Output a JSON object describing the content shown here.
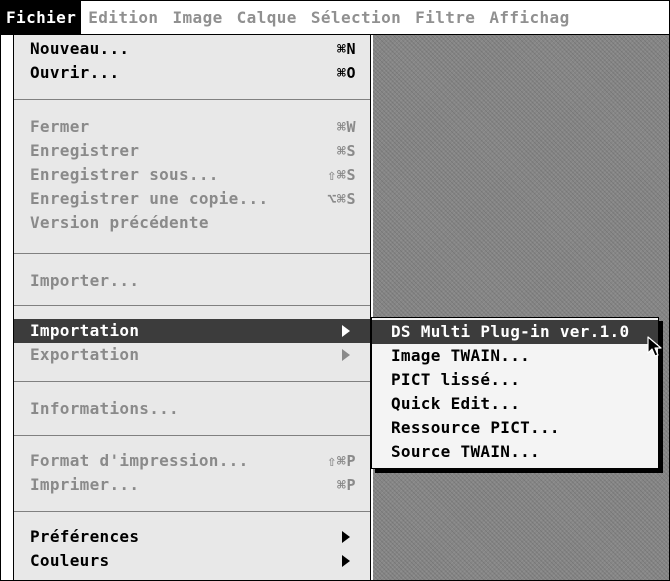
{
  "menubar": {
    "items": [
      "Fichier",
      "Edition",
      "Image",
      "Calque",
      "Sélection",
      "Filtre",
      "Affichag"
    ]
  },
  "menu": {
    "items": [
      {
        "label": "Nouveau...",
        "shortcut": "⌘N",
        "enabled": true
      },
      {
        "label": "Ouvrir...",
        "shortcut": "⌘O",
        "enabled": true
      },
      {
        "label": "Fermer",
        "shortcut": "⌘W",
        "enabled": false
      },
      {
        "label": "Enregistrer",
        "shortcut": "⌘S",
        "enabled": false
      },
      {
        "label": "Enregistrer sous...",
        "shortcut": "⇧⌘S",
        "enabled": false
      },
      {
        "label": "Enregistrer une copie...",
        "shortcut": "⌥⌘S",
        "enabled": false
      },
      {
        "label": "Version précédente",
        "shortcut": "",
        "enabled": false
      },
      {
        "label": "Importer...",
        "shortcut": "",
        "enabled": false
      },
      {
        "label": "Importation",
        "shortcut": "",
        "enabled": true,
        "submenu": true,
        "highlighted": true
      },
      {
        "label": "Exportation",
        "shortcut": "",
        "enabled": false,
        "submenu": true
      },
      {
        "label": "Informations...",
        "shortcut": "",
        "enabled": false
      },
      {
        "label": "Format d'impression...",
        "shortcut": "⇧⌘P",
        "enabled": false
      },
      {
        "label": "Imprimer...",
        "shortcut": "⌘P",
        "enabled": false
      },
      {
        "label": "Préférences",
        "shortcut": "",
        "enabled": true,
        "submenu": true
      },
      {
        "label": "Couleurs",
        "shortcut": "",
        "enabled": true,
        "submenu": true
      }
    ]
  },
  "submenu": {
    "items": [
      {
        "label": "DS Multi Plug-in ver.1.0",
        "highlighted": true
      },
      {
        "label": "Image TWAIN..."
      },
      {
        "label": "PICT lissé..."
      },
      {
        "label": "Quick Edit..."
      },
      {
        "label": "Ressource PICT..."
      },
      {
        "label": "Source TWAIN..."
      }
    ]
  },
  "colors": {
    "highlight": "#3c3c3c",
    "menu_bg": "#e8e8e8",
    "disabled_text": "#8a8a8a"
  }
}
